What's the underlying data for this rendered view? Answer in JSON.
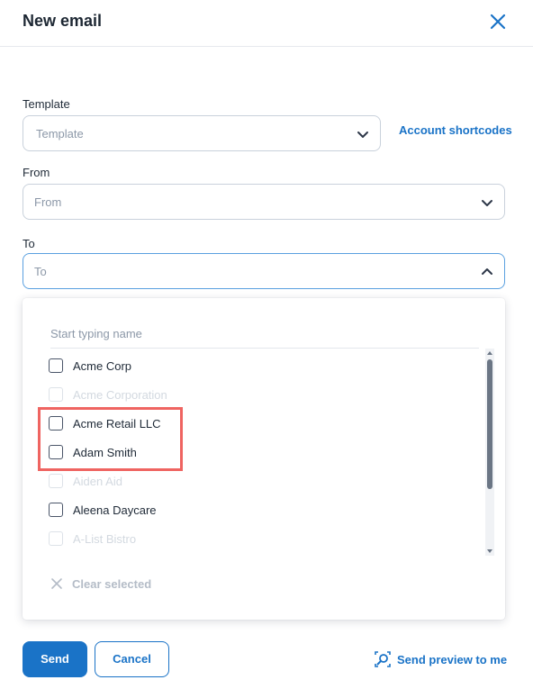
{
  "header": {
    "title": "New email",
    "close_icon": "close-icon"
  },
  "template": {
    "label": "Template",
    "placeholder": "Template",
    "shortcut_link": "Account shortcodes"
  },
  "from": {
    "label": "From",
    "placeholder": "From"
  },
  "to": {
    "label": "To",
    "placeholder": "To",
    "expanded": true
  },
  "dropdown": {
    "search_placeholder": "Start typing name",
    "items": [
      {
        "label": "Acme Corp",
        "disabled": false,
        "checked": false
      },
      {
        "label": "Acme Corporation",
        "disabled": true,
        "checked": false
      },
      {
        "label": "Acme Retail LLC",
        "disabled": false,
        "checked": false
      },
      {
        "label": "Adam Smith",
        "disabled": false,
        "checked": false
      },
      {
        "label": "Aiden Aid",
        "disabled": true,
        "checked": false
      },
      {
        "label": "Aleena Daycare",
        "disabled": false,
        "checked": false
      },
      {
        "label": "A-List Bistro",
        "disabled": true,
        "checked": false
      }
    ],
    "clear_label": "Clear selected"
  },
  "footer": {
    "send_label": "Send",
    "cancel_label": "Cancel",
    "preview_label": "Send preview to me"
  },
  "colors": {
    "primary": "#1a73c7",
    "highlight": "#ef6461",
    "disabled_text": "#d3d9e0"
  }
}
